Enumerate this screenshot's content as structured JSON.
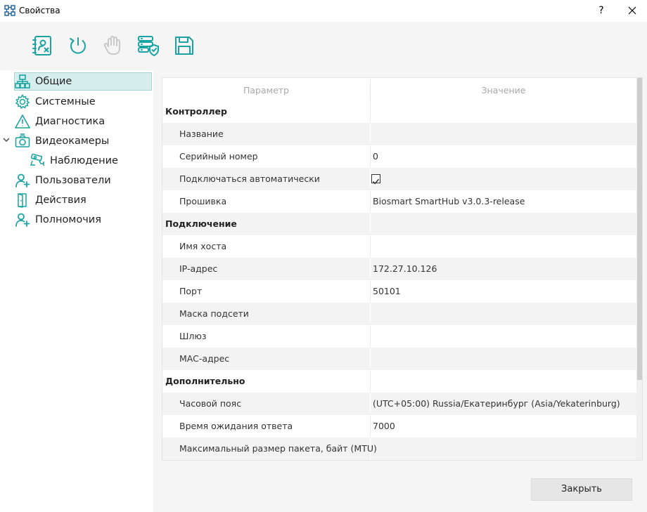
{
  "window": {
    "title": "Свойства",
    "help_label": "?"
  },
  "toolbar": {
    "buttons": [
      {
        "icon": "person-card-remove-icon",
        "enabled": true
      },
      {
        "icon": "power-refresh-icon",
        "enabled": true
      },
      {
        "icon": "hand-stop-icon",
        "enabled": false
      },
      {
        "icon": "server-shield-icon",
        "enabled": true
      },
      {
        "icon": "save-floppy-icon",
        "enabled": true
      }
    ]
  },
  "sidebar": {
    "items": [
      {
        "label": "Общие",
        "icon": "network-tree-icon",
        "selected": true
      },
      {
        "label": "Системные",
        "icon": "gear-icon"
      },
      {
        "label": "Диагностика",
        "icon": "warning-triangle-icon"
      },
      {
        "label": "Видеокамеры",
        "icon": "camera-icon",
        "expanded": true
      },
      {
        "label": "Наблюдение",
        "icon": "surveillance-camera-icon",
        "child": true
      },
      {
        "label": "Пользователи",
        "icon": "user-add-icon"
      },
      {
        "label": "Действия",
        "icon": "door-icon"
      },
      {
        "label": "Полномочия",
        "icon": "user-add-icon"
      }
    ]
  },
  "table": {
    "header": {
      "param": "Параметр",
      "value": "Значение"
    },
    "rows": [
      {
        "type": "group",
        "param": "Контроллер",
        "value": ""
      },
      {
        "type": "item",
        "param": "Название",
        "value": ""
      },
      {
        "type": "item",
        "param": "Серийный номер",
        "value": "0"
      },
      {
        "type": "item",
        "param": "Подключаться автоматически",
        "value": "",
        "checkbox": true,
        "checked": true
      },
      {
        "type": "item",
        "param": "Прошивка",
        "value": "Biosmart SmartHub v3.0.3-release"
      },
      {
        "type": "group",
        "param": "Подключение",
        "value": ""
      },
      {
        "type": "item",
        "param": "Имя хоста",
        "value": ""
      },
      {
        "type": "item",
        "param": "IP-адрес",
        "value": "172.27.10.126"
      },
      {
        "type": "item",
        "param": "Порт",
        "value": "50101"
      },
      {
        "type": "item",
        "param": "Маска подсети",
        "value": ""
      },
      {
        "type": "item",
        "param": "Шлюз",
        "value": ""
      },
      {
        "type": "item",
        "param": "MAC-адрес",
        "value": ""
      },
      {
        "type": "group",
        "param": "Дополнительно",
        "value": ""
      },
      {
        "type": "item",
        "param": "Часовой пояс",
        "value": "(UTC+05:00) Russia/Екатеринбург (Asia/Yekaterinburg)"
      },
      {
        "type": "item",
        "param": "Время ожидания ответа",
        "value": "7000"
      },
      {
        "type": "item",
        "param": "Максимальный размер пакета, байт (MTU)",
        "value": ""
      }
    ]
  },
  "footer": {
    "close_label": "Закрыть"
  },
  "colors": {
    "accent": "#1aa3a3",
    "selected_bg": "#d6eeee",
    "disabled": "#c9c9c9"
  }
}
